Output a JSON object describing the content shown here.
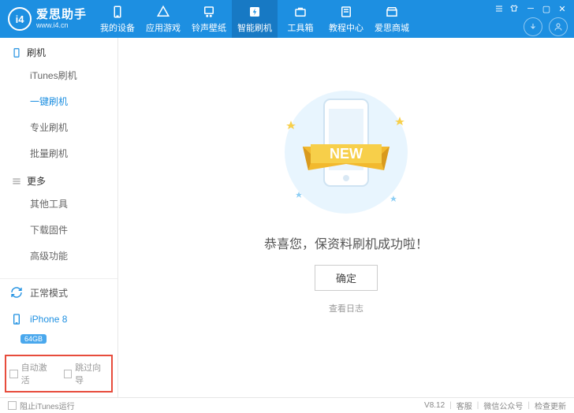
{
  "brand": {
    "logo_text": "i4",
    "name": "爱思助手",
    "url": "www.i4.cn"
  },
  "nav": [
    {
      "label": "我的设备",
      "icon": "phone"
    },
    {
      "label": "应用游戏",
      "icon": "apps"
    },
    {
      "label": "铃声壁纸",
      "icon": "music"
    },
    {
      "label": "智能刷机",
      "icon": "flash",
      "active": true
    },
    {
      "label": "工具箱",
      "icon": "toolbox"
    },
    {
      "label": "教程中心",
      "icon": "book"
    },
    {
      "label": "爱思商城",
      "icon": "store"
    }
  ],
  "sidebar": {
    "group1": {
      "title": "刷机",
      "items": [
        "iTunes刷机",
        "一键刷机",
        "专业刷机",
        "批量刷机"
      ],
      "active_index": 1
    },
    "group2": {
      "title": "更多",
      "items": [
        "其他工具",
        "下载固件",
        "高级功能"
      ]
    },
    "mode": "正常模式",
    "device": {
      "name": "iPhone 8",
      "storage": "64GB"
    },
    "checkboxes": [
      "自动激活",
      "跳过向导"
    ]
  },
  "main": {
    "ribbon_text": "NEW",
    "message": "恭喜您，保资料刷机成功啦！",
    "ok_label": "确定",
    "log_link": "查看日志"
  },
  "footer": {
    "block_itunes": "阻止iTunes运行",
    "version": "V8.12",
    "links": [
      "客服",
      "微信公众号",
      "检查更新"
    ]
  }
}
